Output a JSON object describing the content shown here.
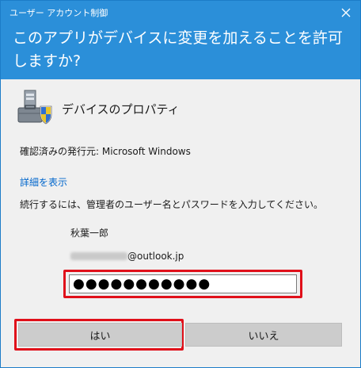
{
  "window": {
    "title": "ユーザー アカウント制御",
    "close_icon": "close-icon"
  },
  "header": {
    "question": "このアプリがデバイスに変更を加えることを許可しますか?",
    "background_color": "#2b8fd9"
  },
  "app": {
    "icon": "device-properties-icon",
    "name": "デバイスのプロパティ"
  },
  "publisher": {
    "text": "確認済みの発行元: Microsoft Windows"
  },
  "details_link": {
    "label": "詳細を表示"
  },
  "instruction": {
    "text": "続行するには、管理者のユーザー名とパスワードを入力してください。"
  },
  "credentials": {
    "user_name": "秋葉一郎",
    "email_domain": "@outlook.jp",
    "password_value": "●●●●●●●●●●●"
  },
  "buttons": {
    "yes_label": "はい",
    "no_label": "いいえ"
  },
  "colors": {
    "highlight": "#e0101a",
    "link": "#0066cc"
  }
}
